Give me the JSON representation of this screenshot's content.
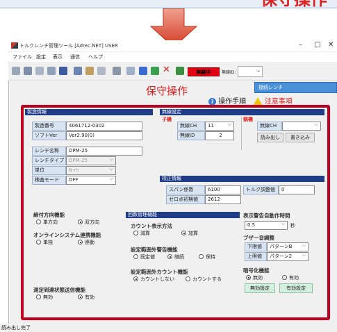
{
  "banner": {
    "title": "保守操作"
  },
  "window": {
    "title": "トルクレンチ管理ツール [Adrec.NET] USER",
    "controls": {
      "minimize": "–",
      "maximize": "□",
      "close": "✕"
    }
  },
  "menu": [
    "ファイル",
    "設定",
    "表示",
    "通信",
    "ヘルプ"
  ],
  "toolbar": {
    "musen_label": "無線中",
    "musen_id_label": "無線ID:",
    "musen_id_value": "-"
  },
  "page": {
    "title": "保守操作",
    "connected": "接続レンチ",
    "help": "操作手順",
    "caution": "注意事項"
  },
  "mfg": {
    "header": "製造情報",
    "serial_label": "製造番号",
    "serial_value": "4061712-0302",
    "soft_label": "ソフトVer",
    "soft_value": "Ver2.90(0)",
    "wrench_name_label": "レンチ名称",
    "wrench_name_value": "DPM-25",
    "wrench_type_label": "レンチタイプ",
    "wrench_type_value": "DPM-25",
    "unit_label": "単位",
    "unit_value": "N·m",
    "check_mode_label": "検査モード",
    "check_mode_value": "OFF"
  },
  "wireless": {
    "header": "無線設定",
    "child_label": "子機",
    "ch_label": "無線CH",
    "ch_value": "11",
    "id_label": "無線ID",
    "id_value": "2",
    "parent_label": "親機",
    "parent_ch_label": "無線CH",
    "parent_ch_value": "",
    "read_btn": "読み出し",
    "write_btn": "書き込み"
  },
  "calib": {
    "header": "校正情報",
    "span_label": "スパン係数",
    "span_value": "6100",
    "torque_adj_label": "トルク調整値",
    "torque_adj_value": "0",
    "zero_label": "ゼロ点初期値",
    "zero_value": "2612"
  },
  "tighten_dir": {
    "title": "締付方向機能",
    "options": [
      "単方向",
      "双方向"
    ],
    "selected": 1
  },
  "online": {
    "title": "オンラインシステム連携機能",
    "options": [
      "単独",
      "連動"
    ],
    "selected": 1
  },
  "measure_notify": {
    "title": "測定到達状態送信機能",
    "options": [
      "無効",
      "有効"
    ],
    "selected": 1
  },
  "count_mgmt": {
    "header": "回数管理機能",
    "display_title": "カウント表示方法",
    "display_options": [
      "減算",
      "加算"
    ],
    "display_selected": 1,
    "warn_title": "設定範囲外警告機能",
    "warn_options": [
      "既定値",
      "継続",
      "保持"
    ],
    "warn_selected": 1,
    "count_title": "設定範囲外カウント機能",
    "count_options": [
      "カウントしない",
      "カウントする"
    ],
    "count_selected": 0
  },
  "display_warn": {
    "title": "表示警告自動作時間",
    "value": "0.5",
    "unit": "秒"
  },
  "buzzer": {
    "title": "ブザー音調整",
    "lower_label": "下限値",
    "lower_value": "パターンB",
    "upper_label": "上限値",
    "upper_value": "パターン2"
  },
  "encrypt": {
    "title": "暗号化機能",
    "options": [
      "無効",
      "有効"
    ],
    "selected": 0,
    "disable_btn": "無効設定",
    "enable_btn": "有効設定"
  },
  "status": "読み出し完了",
  "colors": {
    "accent_red": "#e02020",
    "header_navy": "#1f3c88",
    "frame_red": "#c1001f"
  }
}
